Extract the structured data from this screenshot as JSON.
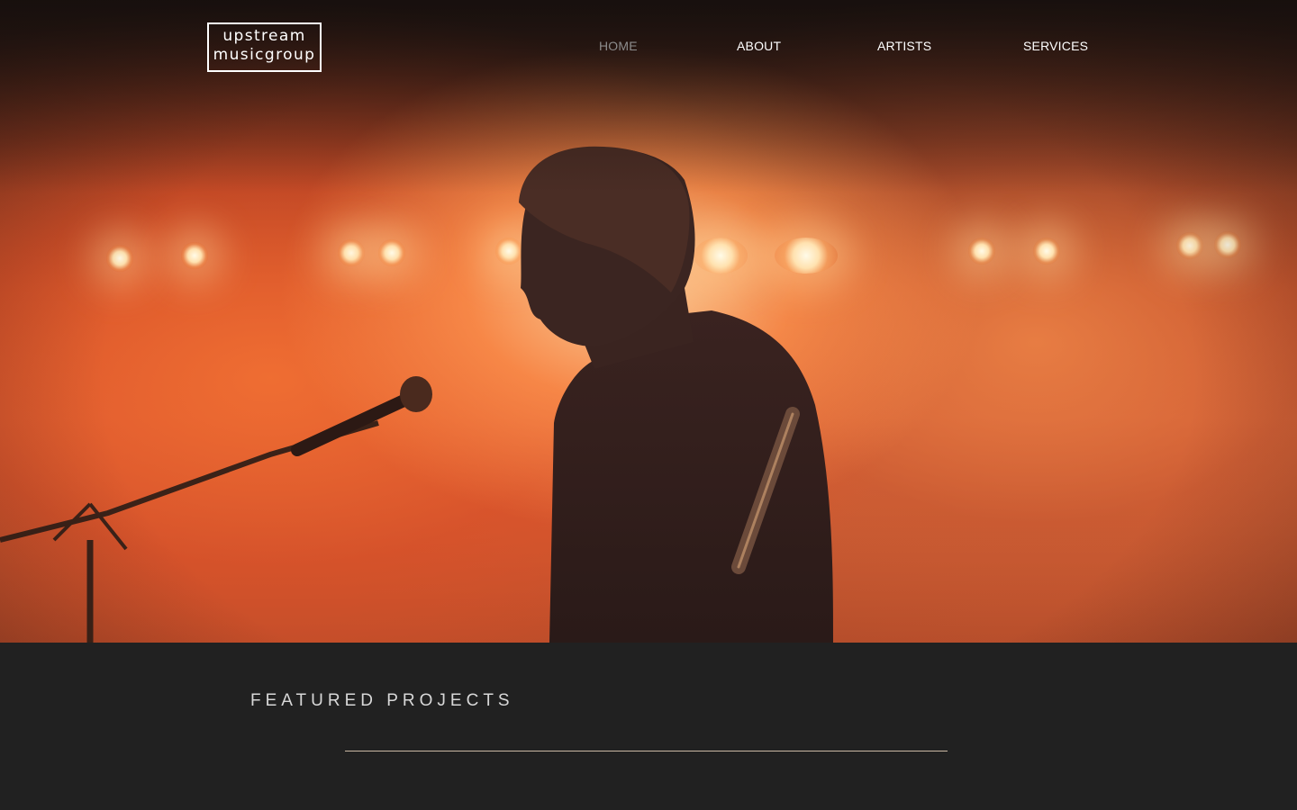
{
  "brand": {
    "logo_line1": "upstream",
    "logo_line2": "musicgroup"
  },
  "nav": {
    "items": [
      {
        "label": "HOME",
        "active": true
      },
      {
        "label": "ABOUT",
        "active": false
      },
      {
        "label": "ARTISTS",
        "active": false
      },
      {
        "label": "SERVICES",
        "active": false
      }
    ]
  },
  "sections": {
    "featured_title": "FEATURED PROJECTS"
  },
  "colors": {
    "page_background": "#212121",
    "nav_active": "#8c8c8c",
    "nav_default": "#ffffff",
    "divider": "#cbb9a3",
    "hero_glow": "#e0693a"
  },
  "hero": {
    "image": "concert-performer-silhouette"
  }
}
